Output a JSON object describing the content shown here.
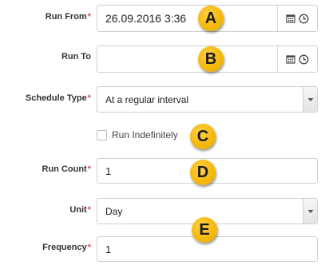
{
  "form": {
    "run_from": {
      "label": "Run From",
      "required": "*",
      "value": "26.09.2016 3:36"
    },
    "run_to": {
      "label": "Run To",
      "value": ""
    },
    "schedule_type": {
      "label": "Schedule Type",
      "required": "*",
      "value": "At a regular interval"
    },
    "run_indefinitely": {
      "label": "Run Indefinitely",
      "checked": false
    },
    "run_count": {
      "label": "Run Count",
      "required": "*",
      "value": "1"
    },
    "unit": {
      "label": "Unit",
      "required": "*",
      "value": "Day"
    },
    "frequency": {
      "label": "Frequency",
      "required": "*",
      "value": "1"
    }
  },
  "callouts": [
    "A",
    "B",
    "C",
    "D",
    "E"
  ],
  "colors": {
    "required_marker": "#d9534f",
    "callout_fill": "#f5b90b",
    "field_border": "#cfcfcf"
  },
  "icons": [
    "calendar-icon",
    "clock-icon",
    "chevron-down-icon"
  ]
}
